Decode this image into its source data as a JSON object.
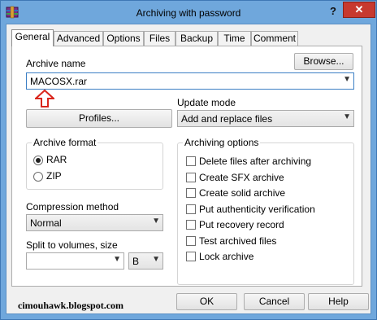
{
  "window": {
    "title": "Archiving with password",
    "help_label": "?",
    "close_label": "✕"
  },
  "tabs": [
    {
      "label": "General"
    },
    {
      "label": "Advanced"
    },
    {
      "label": "Options"
    },
    {
      "label": "Files"
    },
    {
      "label": "Backup"
    },
    {
      "label": "Time"
    },
    {
      "label": "Comment"
    }
  ],
  "general": {
    "archive_name_label": "Archive name",
    "browse_label": "Browse...",
    "archive_name_value": "MACOSX.rar",
    "profiles_label": "Profiles...",
    "update_mode_label": "Update mode",
    "update_mode_value": "Add and replace files",
    "archive_format_label": "Archive format",
    "formats": [
      {
        "label": "RAR",
        "selected": true
      },
      {
        "label": "ZIP",
        "selected": false
      }
    ],
    "compression_method_label": "Compression method",
    "compression_method_value": "Normal",
    "split_label": "Split to volumes, size",
    "split_value": "",
    "split_unit_value": "B",
    "archiving_options_label": "Archiving options",
    "options": [
      {
        "label": "Delete files after archiving",
        "checked": false
      },
      {
        "label": "Create SFX archive",
        "checked": false
      },
      {
        "label": "Create solid archive",
        "checked": false
      },
      {
        "label": "Put authenticity verification",
        "checked": false
      },
      {
        "label": "Put recovery record",
        "checked": false
      },
      {
        "label": "Test archived files",
        "checked": false
      },
      {
        "label": "Lock archive",
        "checked": false
      }
    ]
  },
  "footer": {
    "watermark": "cimouhawk.blogspot.com",
    "ok_label": "OK",
    "cancel_label": "Cancel",
    "help_label": "Help"
  },
  "colors": {
    "title_bar": "#6fa7dc",
    "close_button": "#c7392f",
    "annotation_arrow": "#d9261c"
  },
  "icons": {
    "app": "winrar-icon",
    "annotation": "red-up-arrow-icon"
  }
}
